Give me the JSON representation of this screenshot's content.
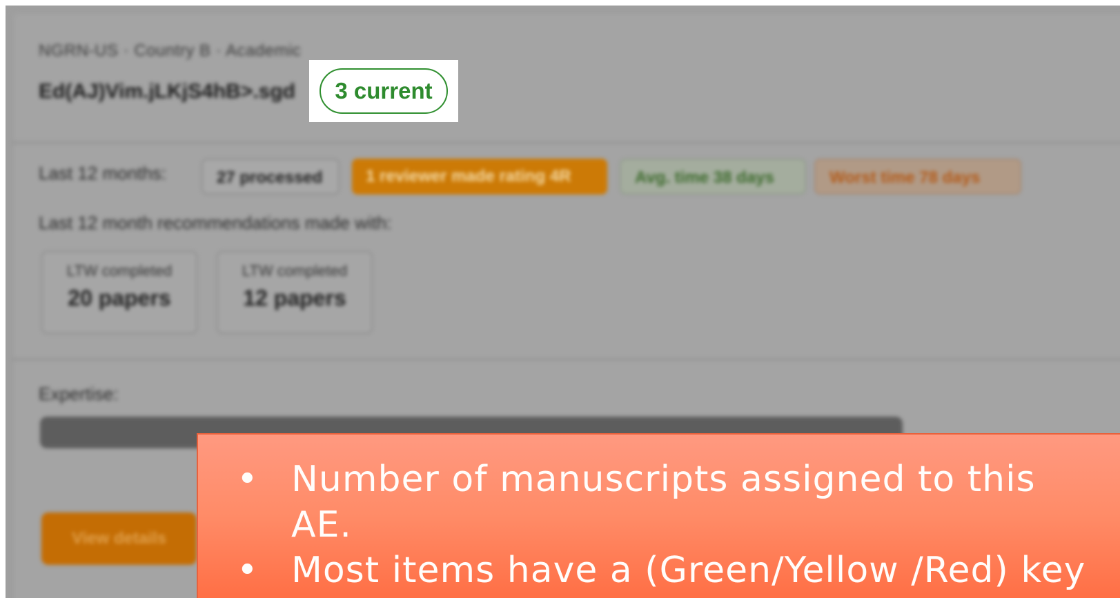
{
  "background_screen": {
    "eyebrow": "NGRN-US · Country B · Academic",
    "ae_name": "Ed(AJ)Vim.jLKjS4hB>.sgd",
    "current_badge": "3 current",
    "stats_label": "Last 12 months:",
    "stats": [
      {
        "label": "27 processed"
      },
      {
        "label": "1 reviewer made rating 4R"
      },
      {
        "label": "Avg. time 38 days"
      },
      {
        "label": "Worst time 78 days"
      }
    ],
    "recs_label": "Last 12 month recommendations made with:",
    "paper_boxes": [
      {
        "line1": "LTW completed",
        "line2": "20 papers"
      },
      {
        "line1": "LTW completed",
        "line2": "12 papers"
      }
    ],
    "expertise_label": "Expertise:",
    "action_button": "View details"
  },
  "callout": {
    "bullets": [
      "Number of manuscripts assigned to this AE.",
      "Most items have a (Green/Yellow /Red) key"
    ]
  },
  "colors": {
    "accent_green": "#2e8b2e",
    "callout_orange": "#ff7f57",
    "blurred_orange": "#cc7a06"
  }
}
